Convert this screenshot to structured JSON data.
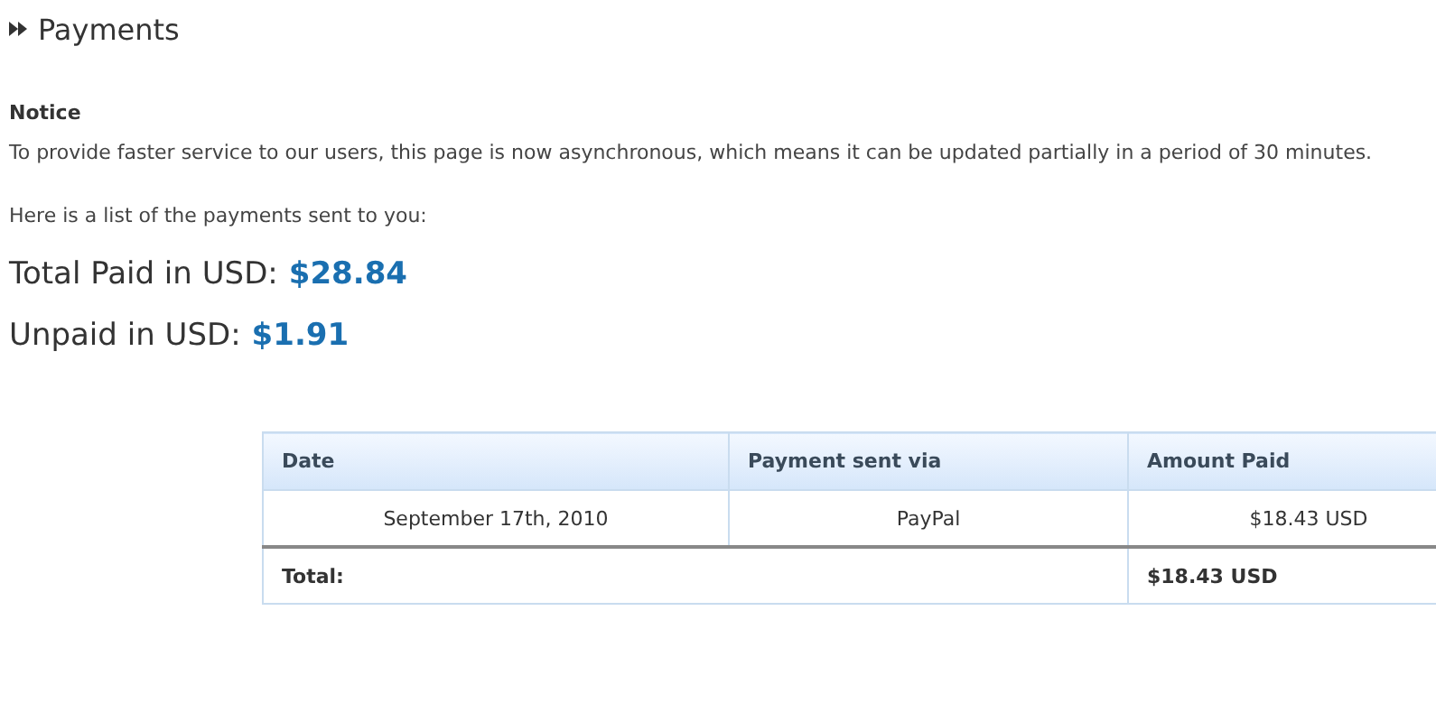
{
  "page_title": "Payments",
  "notice": {
    "heading": "Notice",
    "text": "To provide faster service to our users, this page is now asynchronous, which means it can be updated partially in a period of 30 minutes."
  },
  "intro": "Here is a list of the payments sent to you:",
  "totals": [
    {
      "label": "Total Paid in USD:",
      "value": "$28.84"
    },
    {
      "label": "Unpaid in USD:",
      "value": "$1.91"
    }
  ],
  "table": {
    "columns": [
      "Date",
      "Payment sent via",
      "Amount Paid"
    ],
    "rows": [
      [
        "September 17th, 2010",
        "PayPal",
        "$18.43 USD"
      ]
    ],
    "total": {
      "label": "Total:",
      "value": "$18.43 USD"
    }
  }
}
